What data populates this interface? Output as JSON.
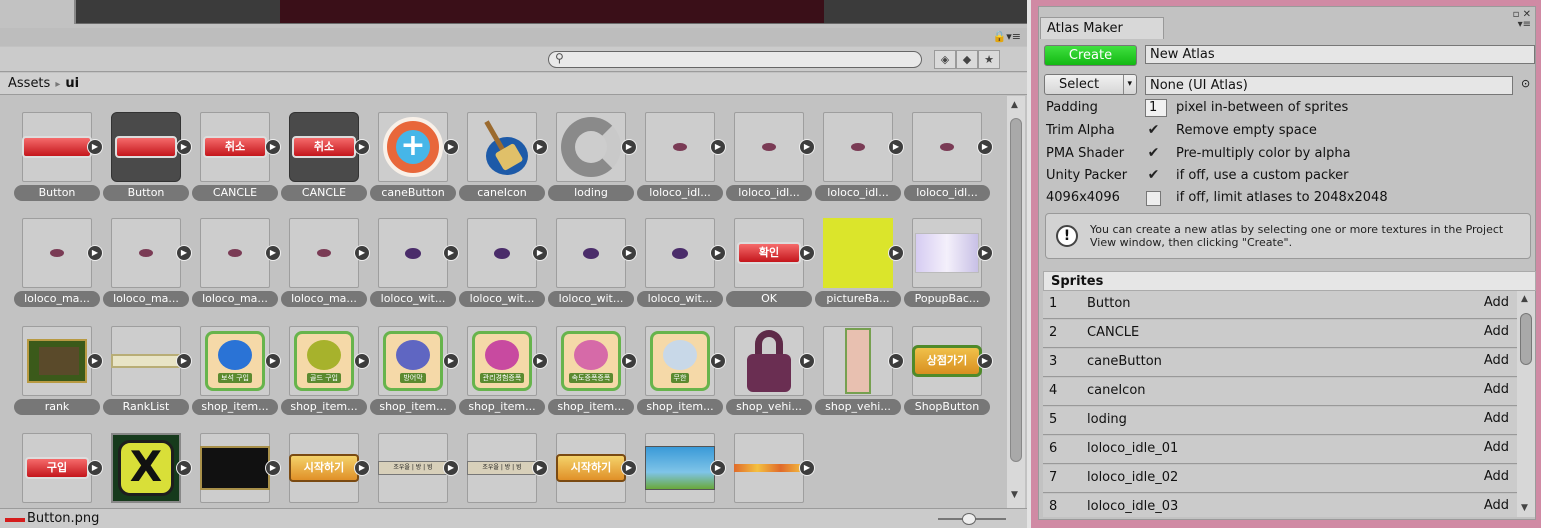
{
  "project": {
    "breadcrumb": {
      "root": "Assets",
      "separator": "▸",
      "current": "ui"
    },
    "search": {
      "placeholder": ""
    },
    "toolbar_icons": [
      "lock-icon",
      "filter-by-type-icon",
      "filter-by-label-icon",
      "favorite-star-icon"
    ],
    "status": {
      "selected_file": "Button.png",
      "zoom_level": 0.45
    },
    "assets": [
      {
        "label": "Button",
        "art": "red-button"
      },
      {
        "label": "Button",
        "art": "red-button-dark"
      },
      {
        "label": "CANCLE",
        "art": "cancel-button",
        "text": "취소"
      },
      {
        "label": "CANCLE",
        "art": "cancel-button-dark",
        "text": "취소"
      },
      {
        "label": "caneButton",
        "art": "plus-circle"
      },
      {
        "label": "caneIcon",
        "art": "broom"
      },
      {
        "label": "loding",
        "art": "ring"
      },
      {
        "label": "loloco_idl...",
        "art": "tiny-sprite"
      },
      {
        "label": "loloco_idl...",
        "art": "tiny-sprite"
      },
      {
        "label": "loloco_idl...",
        "art": "tiny-sprite"
      },
      {
        "label": "loloco_idl...",
        "art": "tiny-sprite"
      },
      {
        "label": "loloco_ma...",
        "art": "tiny-sprite"
      },
      {
        "label": "loloco_ma...",
        "art": "tiny-sprite"
      },
      {
        "label": "loloco_ma...",
        "art": "tiny-sprite"
      },
      {
        "label": "loloco_ma...",
        "art": "tiny-sprite"
      },
      {
        "label": "loloco_wit...",
        "art": "tiny-witch"
      },
      {
        "label": "loloco_wit...",
        "art": "tiny-witch"
      },
      {
        "label": "loloco_wit...",
        "art": "tiny-witch"
      },
      {
        "label": "loloco_wit...",
        "art": "tiny-witch"
      },
      {
        "label": "OK",
        "art": "ok-button",
        "text": "확인"
      },
      {
        "label": "pictureBa...",
        "art": "yellow-square"
      },
      {
        "label": "PopupBac...",
        "art": "popup-bg"
      },
      {
        "label": "rank",
        "art": "rank-panel"
      },
      {
        "label": "RankList",
        "art": "rank-bar"
      },
      {
        "label": "shop_item...",
        "art": "shop-gem",
        "text": "보석 구입"
      },
      {
        "label": "shop_item...",
        "art": "shop-gold",
        "text": "골드 구입"
      },
      {
        "label": "shop_item...",
        "art": "shop-shield",
        "text": "방어막"
      },
      {
        "label": "shop_item...",
        "art": "shop-potion",
        "text": "관리경험증폭"
      },
      {
        "label": "shop_item...",
        "art": "shop-potion2",
        "text": "속도증폭증폭"
      },
      {
        "label": "shop_item...",
        "art": "shop-wings",
        "text": "무한"
      },
      {
        "label": "shop_vehi...",
        "art": "padlock"
      },
      {
        "label": "shop_vehi...",
        "art": "tall-card"
      },
      {
        "label": "ShopButton",
        "art": "shop-button",
        "text": "상점가기"
      },
      {
        "label": "",
        "art": "buy-button",
        "text": "구입"
      },
      {
        "label": "",
        "art": "x-icon"
      },
      {
        "label": "",
        "art": "dark-panel"
      },
      {
        "label": "",
        "art": "start-button",
        "text": "시작하기"
      },
      {
        "label": "",
        "art": "small-bar",
        "text": "조우을 | 방 | 빙"
      },
      {
        "label": "",
        "art": "small-bar2",
        "text": "조우을 | 방 | 빙"
      },
      {
        "label": "",
        "art": "start-button",
        "text": "시작하기"
      },
      {
        "label": "",
        "art": "scene-image"
      },
      {
        "label": "",
        "art": "tiny-strip"
      },
      {
        "label": "",
        "art": "sprite-sheet"
      }
    ]
  },
  "atlas_maker": {
    "tab_title": "Atlas Maker",
    "create_label": "Create",
    "atlas_name": "New Atlas",
    "select_label": "Select",
    "select_value": "None (UI Atlas)",
    "options": [
      {
        "label": "Padding",
        "value": "1",
        "kind": "number",
        "desc": "pixel in-between of sprites"
      },
      {
        "label": "Trim Alpha",
        "checked": true,
        "kind": "check",
        "desc": "Remove empty space"
      },
      {
        "label": "PMA Shader",
        "checked": true,
        "kind": "check",
        "desc": "Pre-multiply color by alpha"
      },
      {
        "label": "Unity Packer",
        "checked": true,
        "kind": "check",
        "desc": "if off, use a custom packer"
      },
      {
        "label": "4096x4096",
        "checked": false,
        "kind": "check",
        "desc": "if off, limit atlases to 2048x2048"
      }
    ],
    "info_text": "You can create a new atlas by selecting one or more textures in the Project View window, then clicking \"Create\".",
    "sprites_header": "Sprites",
    "sprites": [
      {
        "n": "1",
        "name": "Button",
        "action": "Add"
      },
      {
        "n": "2",
        "name": "CANCLE",
        "action": "Add"
      },
      {
        "n": "3",
        "name": "caneButton",
        "action": "Add"
      },
      {
        "n": "4",
        "name": "caneIcon",
        "action": "Add"
      },
      {
        "n": "5",
        "name": "loding",
        "action": "Add"
      },
      {
        "n": "6",
        "name": "loloco_idle_01",
        "action": "Add"
      },
      {
        "n": "7",
        "name": "loloco_idle_02",
        "action": "Add"
      },
      {
        "n": "8",
        "name": "loloco_idle_03",
        "action": "Add"
      }
    ],
    "colors": {
      "accent_green": "#19c019",
      "window_frame": "#d08aa4"
    }
  }
}
